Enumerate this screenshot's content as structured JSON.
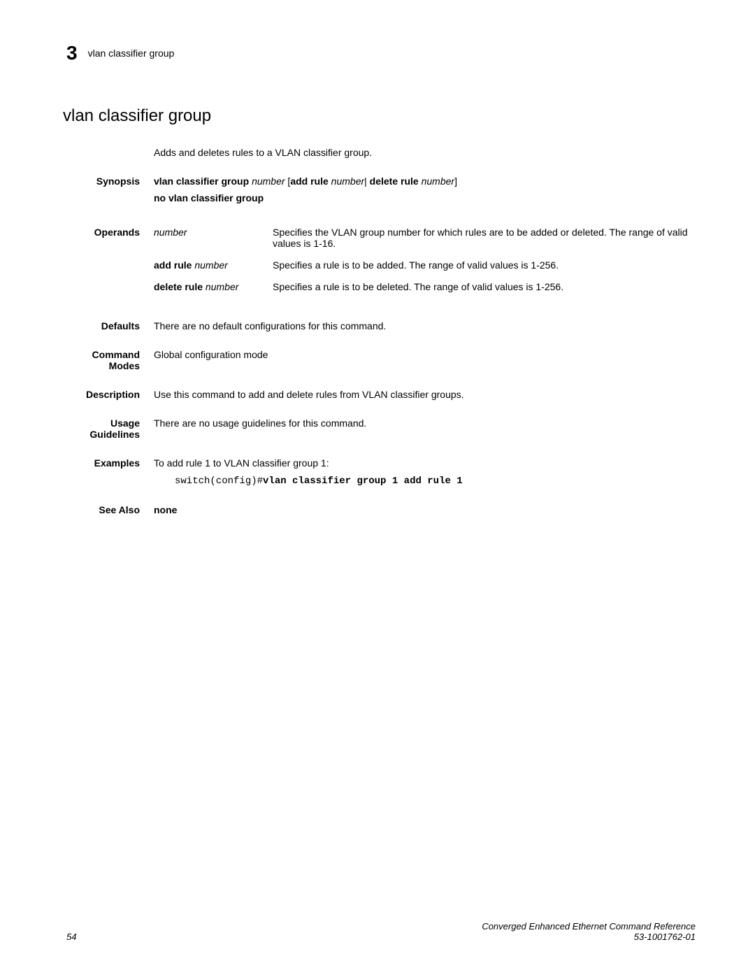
{
  "header": {
    "chapter_num": "3",
    "title": "vlan classifier group"
  },
  "section_title": "vlan classifier group",
  "intro": "Adds and deletes rules to a VLAN classifier group.",
  "synopsis": {
    "label": "Synopsis",
    "line1_bold1": "vlan classifier group",
    "line1_italic1": "number",
    "line1_open_bracket": " [",
    "line1_bold2": "add rule",
    "line1_italic2": "number",
    "line1_pipe": "|",
    "line1_bold3": " delete rule",
    "line1_italic3": "number",
    "line1_close_bracket": "]",
    "line2_bold": "no vlan classifier group"
  },
  "operands": {
    "label": "Operands",
    "rows": [
      {
        "name_italic": "number",
        "desc": "Specifies the VLAN group number for which rules are to be added or deleted. The range of valid values is 1-16."
      },
      {
        "name_bold": "add rule",
        "name_italic": "number",
        "desc": "Specifies a rule is to be added. The range of valid values is 1-256."
      },
      {
        "name_bold": "delete rule",
        "name_italic": "number",
        "desc": "Specifies a rule is to be deleted. The range of valid values is 1-256."
      }
    ]
  },
  "defaults": {
    "label": "Defaults",
    "text": "There are no default configurations for this command."
  },
  "command_modes": {
    "label1": "Command",
    "label2": "Modes",
    "text": "Global configuration mode"
  },
  "description": {
    "label": "Description",
    "text": "Use this command to add and delete rules from VLAN classifier groups."
  },
  "usage": {
    "label1": "Usage",
    "label2": "Guidelines",
    "text": "There are no usage guidelines for this command."
  },
  "examples": {
    "label": "Examples",
    "text": "To add rule 1 to VLAN classifier group 1:",
    "code_prefix": "switch(config)#",
    "code_bold": "vlan classifier group 1 add rule 1"
  },
  "see_also": {
    "label": "See Also",
    "text": "none"
  },
  "footer": {
    "page_num": "54",
    "doc_title": "Converged Enhanced Ethernet Command Reference",
    "doc_id": "53-1001762-01"
  }
}
